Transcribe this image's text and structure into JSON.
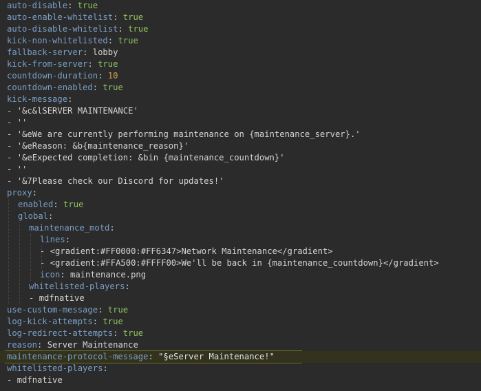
{
  "window": {
    "title": "",
    "kind": "yaml-config-editor"
  },
  "colors": {
    "background": "#2b2b2b",
    "key": "#9876aa",
    "value_string": "#a9b7c6",
    "value_bool": "#cc7832",
    "value_number": "#6897bb",
    "punct": "#a9b7c6",
    "line_highlight": "#32321f",
    "selection_box": "#3a3a1c"
  },
  "editor": {
    "highlighted_line_index": 30,
    "lines": [
      {
        "indent": 0,
        "tokens": [
          {
            "t": "auto-disable",
            "c": "key"
          },
          {
            "t": ": ",
            "c": "punct"
          },
          {
            "t": "true",
            "c": "bool"
          }
        ]
      },
      {
        "indent": 0,
        "tokens": [
          {
            "t": "auto-enable-whitelist",
            "c": "key"
          },
          {
            "t": ": ",
            "c": "punct"
          },
          {
            "t": "true",
            "c": "bool"
          }
        ]
      },
      {
        "indent": 0,
        "tokens": [
          {
            "t": "auto-disable-whitelist",
            "c": "key"
          },
          {
            "t": ": ",
            "c": "punct"
          },
          {
            "t": "true",
            "c": "bool"
          }
        ]
      },
      {
        "indent": 0,
        "tokens": [
          {
            "t": "kick-non-whitelisted",
            "c": "key"
          },
          {
            "t": ": ",
            "c": "punct"
          },
          {
            "t": "true",
            "c": "bool"
          }
        ]
      },
      {
        "indent": 0,
        "tokens": [
          {
            "t": "fallback-server",
            "c": "key"
          },
          {
            "t": ": ",
            "c": "punct"
          },
          {
            "t": "lobby",
            "c": "str"
          }
        ]
      },
      {
        "indent": 0,
        "tokens": [
          {
            "t": "kick-from-server",
            "c": "key"
          },
          {
            "t": ": ",
            "c": "punct"
          },
          {
            "t": "true",
            "c": "bool"
          }
        ]
      },
      {
        "indent": 0,
        "tokens": [
          {
            "t": "countdown-duration",
            "c": "key"
          },
          {
            "t": ": ",
            "c": "punct"
          },
          {
            "t": "10",
            "c": "num"
          }
        ]
      },
      {
        "indent": 0,
        "tokens": [
          {
            "t": "countdown-enabled",
            "c": "key"
          },
          {
            "t": ": ",
            "c": "punct"
          },
          {
            "t": "true",
            "c": "bool"
          }
        ]
      },
      {
        "indent": 0,
        "tokens": [
          {
            "t": "kick-message",
            "c": "key"
          },
          {
            "t": ":",
            "c": "punct"
          }
        ]
      },
      {
        "indent": 0,
        "tokens": [
          {
            "t": "- ",
            "c": "punct"
          },
          {
            "t": "'&c&lSERVER MAINTENANCE'",
            "c": "str"
          }
        ]
      },
      {
        "indent": 0,
        "tokens": [
          {
            "t": "- ",
            "c": "punct"
          },
          {
            "t": "''",
            "c": "str"
          }
        ]
      },
      {
        "indent": 0,
        "tokens": [
          {
            "t": "- ",
            "c": "punct"
          },
          {
            "t": "'&eWe are currently performing maintenance on {maintenance_server}.'",
            "c": "str"
          }
        ]
      },
      {
        "indent": 0,
        "tokens": [
          {
            "t": "- ",
            "c": "punct"
          },
          {
            "t": "'&eReason: &b{maintenance_reason}'",
            "c": "str"
          }
        ]
      },
      {
        "indent": 0,
        "tokens": [
          {
            "t": "- ",
            "c": "punct"
          },
          {
            "t": "'&eExpected completion: &bin {maintenance_countdown}'",
            "c": "str"
          }
        ]
      },
      {
        "indent": 0,
        "tokens": [
          {
            "t": "- ",
            "c": "punct"
          },
          {
            "t": "''",
            "c": "str"
          }
        ]
      },
      {
        "indent": 0,
        "tokens": [
          {
            "t": "- ",
            "c": "punct"
          },
          {
            "t": "'&7Please check our Discord for updates!'",
            "c": "str"
          }
        ]
      },
      {
        "indent": 0,
        "tokens": [
          {
            "t": "proxy",
            "c": "key"
          },
          {
            "t": ":",
            "c": "punct"
          }
        ]
      },
      {
        "indent": 1,
        "tokens": [
          {
            "t": "enabled",
            "c": "key"
          },
          {
            "t": ": ",
            "c": "punct"
          },
          {
            "t": "true",
            "c": "bool"
          }
        ]
      },
      {
        "indent": 1,
        "tokens": [
          {
            "t": "global",
            "c": "key"
          },
          {
            "t": ":",
            "c": "punct"
          }
        ]
      },
      {
        "indent": 2,
        "tokens": [
          {
            "t": "maintenance_motd",
            "c": "key"
          },
          {
            "t": ":",
            "c": "punct"
          }
        ]
      },
      {
        "indent": 3,
        "tokens": [
          {
            "t": "lines",
            "c": "key"
          },
          {
            "t": ":",
            "c": "punct"
          }
        ]
      },
      {
        "indent": 3,
        "tokens": [
          {
            "t": "- ",
            "c": "punct"
          },
          {
            "t": "<gradient:#FF0000:#FF6347>Network Maintenance</gradient>",
            "c": "str"
          }
        ]
      },
      {
        "indent": 3,
        "tokens": [
          {
            "t": "- ",
            "c": "punct"
          },
          {
            "t": "<gradient:#FFA500:#FFFF00>We'll be back in {maintenance_countdown}</gradient>",
            "c": "str"
          }
        ]
      },
      {
        "indent": 3,
        "tokens": [
          {
            "t": "icon",
            "c": "key"
          },
          {
            "t": ": ",
            "c": "punct"
          },
          {
            "t": "maintenance.png",
            "c": "str"
          }
        ]
      },
      {
        "indent": 2,
        "tokens": [
          {
            "t": "whitelisted-players",
            "c": "key"
          },
          {
            "t": ":",
            "c": "punct"
          }
        ]
      },
      {
        "indent": 2,
        "tokens": [
          {
            "t": "- ",
            "c": "punct"
          },
          {
            "t": "mdfnative",
            "c": "str"
          }
        ]
      },
      {
        "indent": 0,
        "tokens": [
          {
            "t": "use-custom-message",
            "c": "key"
          },
          {
            "t": ": ",
            "c": "punct"
          },
          {
            "t": "true",
            "c": "bool"
          }
        ]
      },
      {
        "indent": 0,
        "tokens": [
          {
            "t": "log-kick-attempts",
            "c": "key"
          },
          {
            "t": ": ",
            "c": "punct"
          },
          {
            "t": "true",
            "c": "bool"
          }
        ]
      },
      {
        "indent": 0,
        "tokens": [
          {
            "t": "log-redirect-attempts",
            "c": "key"
          },
          {
            "t": ": ",
            "c": "punct"
          },
          {
            "t": "true",
            "c": "bool"
          }
        ]
      },
      {
        "indent": 0,
        "tokens": [
          {
            "t": "reason",
            "c": "key"
          },
          {
            "t": ": ",
            "c": "punct"
          },
          {
            "t": "Server Maintenance",
            "c": "str"
          }
        ]
      },
      {
        "indent": 0,
        "tokens": [
          {
            "t": "maintenance-protocol-message",
            "c": "key"
          },
          {
            "t": ": ",
            "c": "punct"
          },
          {
            "t": "\"§eServer Maintenance!\"",
            "c": "dqstr"
          }
        ]
      },
      {
        "indent": 0,
        "tokens": [
          {
            "t": "whitelisted-players",
            "c": "key"
          },
          {
            "t": ":",
            "c": "punct"
          }
        ]
      },
      {
        "indent": 0,
        "tokens": [
          {
            "t": "- ",
            "c": "punct"
          },
          {
            "t": "mdfnative",
            "c": "str"
          }
        ]
      }
    ]
  }
}
